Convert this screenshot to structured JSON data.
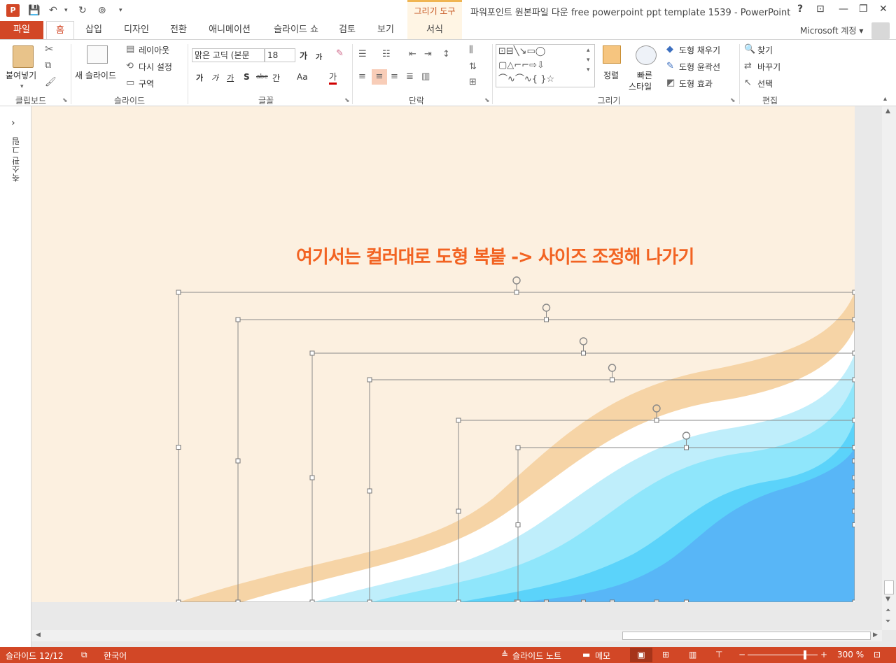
{
  "app": {
    "logo": "P",
    "title": "파워포인트 원본파일 다운 free powerpoint ppt template 1539 - PowerPoint",
    "contextual_group": "그리기 도구",
    "account": "Microsoft 계정",
    "help": "?",
    "minimize": "—",
    "restore": "❐",
    "close": "✕"
  },
  "tabs": {
    "file": "파일",
    "home": "홈",
    "insert": "삽입",
    "design": "디자인",
    "transitions": "전환",
    "animations": "애니메이션",
    "slideshow": "슬라이드 쇼",
    "review": "검토",
    "view": "보기",
    "format": "서식"
  },
  "ribbon": {
    "clipboard": {
      "label": "클립보드",
      "paste": "붙여넣기"
    },
    "slides": {
      "label": "슬라이드",
      "new_slide": "새 슬라이드",
      "layout": "레이아웃",
      "reset": "다시 설정",
      "section": "구역"
    },
    "font": {
      "label": "글꼴",
      "font_name": "맑은 고딕 (본문",
      "font_size": "18",
      "grow": "가",
      "shrink": "가",
      "bold": "가",
      "italic": "가",
      "underline": "가",
      "shadow": "S",
      "strike": "abe",
      "spacing": "간",
      "case": "Aa",
      "color": "가"
    },
    "paragraph": {
      "label": "단락"
    },
    "drawing": {
      "label": "그리기",
      "arrange": "정렬",
      "quick_styles": "빠른",
      "quick_styles_2": "스타일",
      "fill": "도형 채우기",
      "outline": "도형 윤곽선",
      "effects": "도형 효과"
    },
    "editing": {
      "label": "편집",
      "find": "찾기",
      "replace": "바꾸기",
      "select": "선택"
    }
  },
  "left_panel": {
    "label": "축소판 그림",
    "expand": "›"
  },
  "slide": {
    "annotation": "여기서는 컬러대로 도형 복붙 -> 사이즈 조정해 나가기",
    "colors": {
      "bg": "#fcf0e0",
      "peach": "#f6d4a6",
      "white": "#ffffff",
      "blue1": "#bfeefb",
      "blue2": "#8fe6fb",
      "blue3": "#5bd3fa",
      "blue4": "#58b6f7",
      "orange": "#f26322"
    }
  },
  "status": {
    "slide_info": "슬라이드 12/12",
    "language": "한국어",
    "notes": "슬라이드 노트",
    "comments": "메모",
    "zoom": "300 %"
  }
}
